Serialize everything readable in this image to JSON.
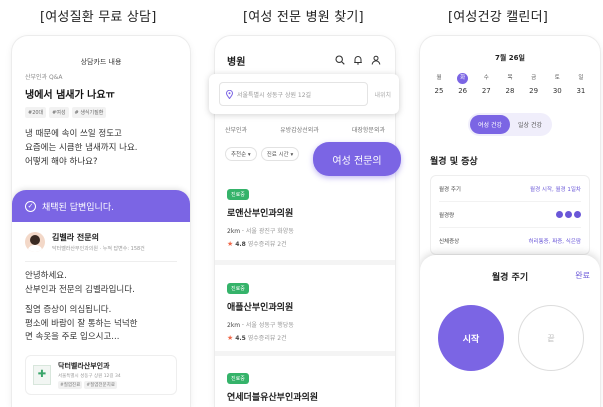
{
  "captions": [
    "[여성질환 무료 상담]",
    "[여성 전문 병원 찾기]",
    "[여성건강 캘린더]"
  ],
  "consult": {
    "header": "상담카드 내용",
    "category": "산부인과 Q&A",
    "title": "냉에서 냄새가 나요ㅠ",
    "chips": [
      "#20대",
      "#여성",
      "# 생식기질환"
    ],
    "body": [
      "냉 때문에 속이 쓰일 정도고",
      "요즘에는 시큼한 냄새까지 나요.",
      "어떻게 해야 하나요?"
    ],
    "answer_banner": "채택된 답변입니다.",
    "doctor_name": "김벨라 전문의",
    "doctor_sub": "닥터벨라산부인과의원 · 누적 답변수: 158건",
    "answer": [
      "안녕하세요.",
      "산부인과 전문의 김벨라입니다.",
      "질염 증상이 의심됩니다.",
      "평소에 바람이 잘 통하는 넉넉한",
      "면 속옷을 주로 입으시고..."
    ],
    "clinic_card": {
      "name": "닥터벨라산부인과",
      "addr": "서울특별시 성동구 상원 12길 34",
      "chips": [
        "#질염진료",
        "#질염전문치료"
      ]
    }
  },
  "finder": {
    "title": "병원",
    "search_placeholder": "서울특별시 성동구 상원 12길",
    "loc_button": "내위치",
    "tabs": [
      "산부인과",
      "유방갑상선외과",
      "대장항문외과"
    ],
    "filters": [
      "추천순 ▾",
      "진료 시간 ▾"
    ],
    "women_button": "여성 전문의",
    "clinics": [
      {
        "badge": "진료중",
        "name": "로앤산부인과의원",
        "dist": "2km",
        "addr": "서울 광진구 화양동",
        "rating": "4.8",
        "reviews": "영수증리뷰 2건"
      },
      {
        "badge": "진료중",
        "name": "애플산부인과의원",
        "dist": "2km",
        "addr": "서울 성동구 행당동",
        "rating": "4.5",
        "reviews": "영수증리뷰 2건"
      },
      {
        "badge": "진료중",
        "name": "연세더블유산부인과의원"
      }
    ]
  },
  "calendar": {
    "month": "7월 26일",
    "days": [
      {
        "dow": "월",
        "num": "25"
      },
      {
        "dow": "화",
        "num": "26"
      },
      {
        "dow": "수",
        "num": "27"
      },
      {
        "dow": "목",
        "num": "28"
      },
      {
        "dow": "금",
        "num": "29"
      },
      {
        "dow": "토",
        "num": "30"
      },
      {
        "dow": "일",
        "num": "31"
      }
    ],
    "pills": [
      "여성 건강",
      "일상 건강"
    ],
    "symptoms_title": "월경 및 증상",
    "rows": [
      {
        "label": "월경 주기",
        "value": "월경 시작, 월경 1일차"
      },
      {
        "label": "월경량",
        "value": ""
      },
      {
        "label": "신체증상",
        "value": "허리통증, 짜증, 식은땀"
      }
    ],
    "sheet_title": "월경 주기",
    "sheet_done": "완료",
    "start_label": "시작",
    "end_label": "끝"
  },
  "colors": {
    "accent": "#7b65e4",
    "open_badge": "#35b36a",
    "star": "#f06a4b"
  }
}
